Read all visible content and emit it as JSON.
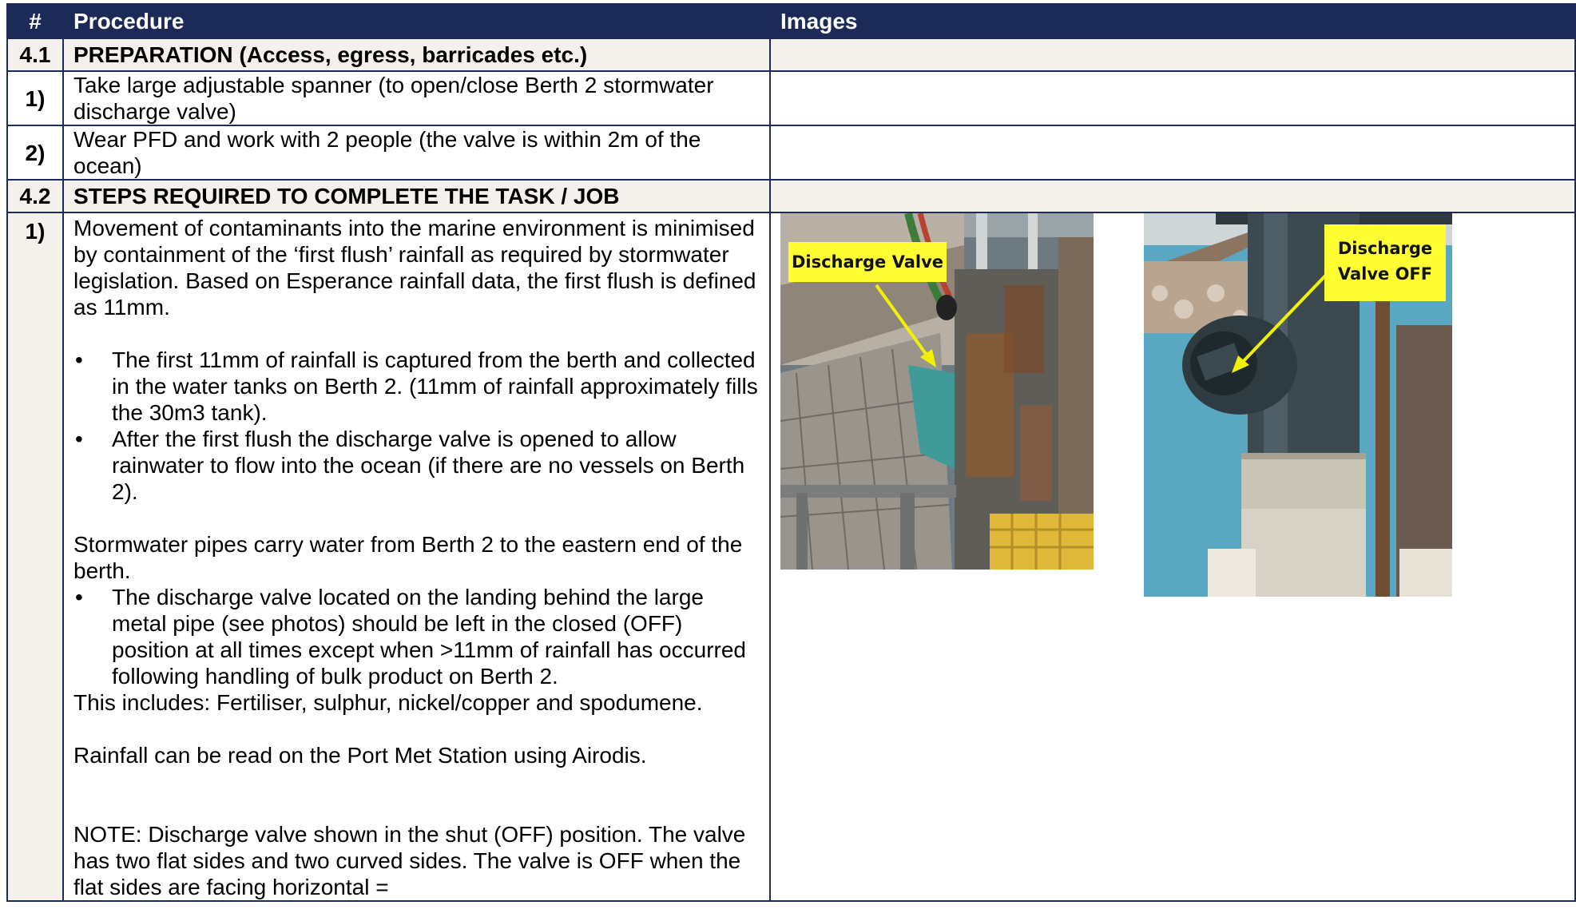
{
  "header": {
    "num": "#",
    "procedure": "Procedure",
    "images": "Images"
  },
  "section1": {
    "num": "4.1",
    "title": "PREPARATION (Access, egress, barricades etc.)"
  },
  "prep_items": [
    {
      "num": "1)",
      "text": "Take large adjustable spanner (to open/close Berth 2 stormwater discharge valve)"
    },
    {
      "num": "2)",
      "text": "Wear PFD and work with 2 people (the valve is within 2m of the ocean)"
    }
  ],
  "section2": {
    "num": "4.2",
    "title": "STEPS REQUIRED TO COMPLETE THE TASK / JOB"
  },
  "step1": {
    "num": "1)",
    "intro": "Movement of contaminants into the marine environment is minimised by containment of the ‘first flush’ rainfall as required by stormwater legislation. Based on Esperance rainfall data, the first flush is defined as 11mm.",
    "bullets_a": [
      "The first 11mm of rainfall is captured from the berth and collected in the water tanks on Berth 2. (11mm of rainfall approximately fills the 30m3 tank).",
      "After the first flush the discharge valve is opened to allow rainwater to flow into the ocean (if there are no vessels on Berth 2)."
    ],
    "pipes": "Stormwater pipes carry water from Berth 2 to the eastern end of the berth.",
    "bullets_b": [
      "The discharge valve located on the landing behind the large metal pipe (see photos) should be left in the closed (OFF) position at all times except when >11mm of rainfall has occurred following handling of bulk product on Berth 2."
    ],
    "includes": "This includes: Fertiliser, sulphur, nickel/copper and spodumene.",
    "rainfall": "Rainfall can be read on the Port Met Station using Airodis.",
    "note": "NOTE: Discharge valve shown in the shut (OFF) position. The valve has two flat sides and two curved sides. The valve is OFF when the flat sides are facing horizontal ="
  },
  "photos": {
    "left_label": "Discharge Valve",
    "right_label_1": "Discharge",
    "right_label_2": "Valve OFF",
    "callout_color": "#ffff33",
    "arrow_color": "#f2f200"
  }
}
